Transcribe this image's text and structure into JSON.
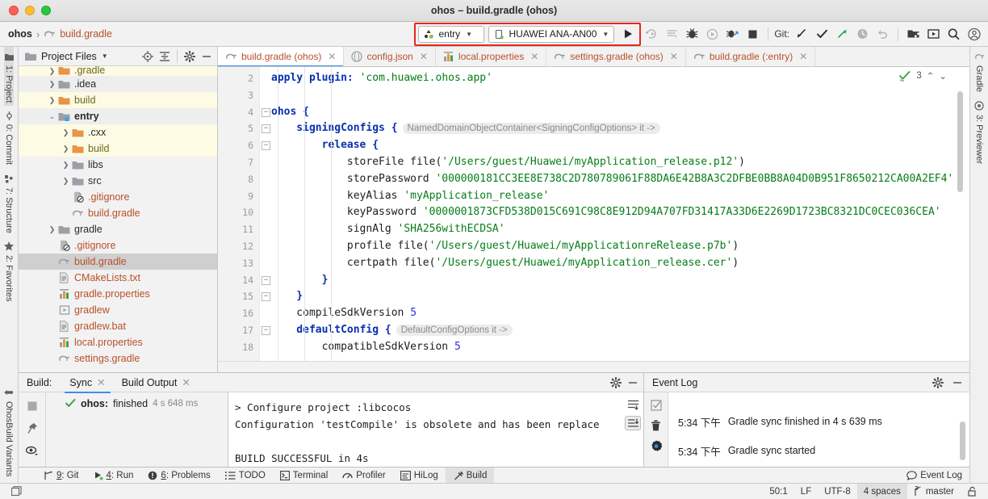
{
  "window": {
    "title": "ohos – build.gradle (ohos)"
  },
  "navbar": {
    "breadcrumb": {
      "root": "ohos",
      "separator": "›",
      "file": "build.gradle"
    },
    "run_config": "entry",
    "device": "HUAWEI ANA-AN00",
    "git_label": "Git:",
    "icons": [
      "run-icon",
      "rerun-icon",
      "run-tests-icon",
      "debug-icon",
      "profile-icon",
      "debug-attach-icon",
      "stop-icon",
      "update-project-icon",
      "commit-icon",
      "push-icon",
      "history-icon",
      "undo-icon",
      "device-manager-icon",
      "previewer-icon",
      "search-everywhere-icon",
      "account-icon"
    ]
  },
  "left_strip": [
    {
      "label": "1: Project",
      "icon": "project-icon",
      "active": true
    },
    {
      "label": "0: Commit",
      "icon": "commit-icon",
      "active": false
    },
    {
      "label": "7: Structure",
      "icon": "structure-icon",
      "active": false
    },
    {
      "label": "2: Favorites",
      "icon": "star-icon",
      "active": false
    },
    {
      "label": "OhosBuild Variants",
      "icon": "variants-icon",
      "active": false
    }
  ],
  "right_strip": [
    {
      "label": "Gradle",
      "icon": "gradle-elephant-icon"
    },
    {
      "label": "3: Previewer",
      "icon": "eye-icon"
    }
  ],
  "project_panel": {
    "title": "Project Files",
    "header_icons": [
      "locate-icon",
      "collapse-all-icon",
      "settings-icon",
      "hide-icon"
    ],
    "tree": [
      {
        "label": ".gradle",
        "depth": 1,
        "arrow": "right",
        "icon": "folder-orange",
        "color": "olive",
        "highlight": "yellow",
        "bold": false,
        "clipped": true
      },
      {
        "label": ".idea",
        "depth": 1,
        "arrow": "right",
        "icon": "folder-gray",
        "color": "dark",
        "highlight": "gray",
        "bold": false
      },
      {
        "label": "build",
        "depth": 1,
        "arrow": "right",
        "icon": "folder-orange",
        "color": "olive",
        "highlight": "yellow",
        "bold": false
      },
      {
        "label": "entry",
        "depth": 1,
        "arrow": "down",
        "icon": "folder-module",
        "color": "dark",
        "highlight": "gray",
        "bold": true
      },
      {
        "label": ".cxx",
        "depth": 2,
        "arrow": "right",
        "icon": "folder-orange",
        "color": "dark",
        "highlight": "yellow",
        "bold": false
      },
      {
        "label": "build",
        "depth": 2,
        "arrow": "right",
        "icon": "folder-orange",
        "color": "olive",
        "highlight": "yellow",
        "bold": false
      },
      {
        "label": "libs",
        "depth": 2,
        "arrow": "right",
        "icon": "folder-gray",
        "color": "dark",
        "highlight": "none",
        "bold": false
      },
      {
        "label": "src",
        "depth": 2,
        "arrow": "right",
        "icon": "folder-gray",
        "color": "dark",
        "highlight": "none",
        "bold": false
      },
      {
        "label": ".gitignore",
        "depth": 2,
        "arrow": "none",
        "icon": "gitignore-file",
        "color": "orange",
        "highlight": "none",
        "bold": false
      },
      {
        "label": "build.gradle",
        "depth": 2,
        "arrow": "none",
        "icon": "gradle-file",
        "color": "orange",
        "highlight": "none",
        "bold": false
      },
      {
        "label": "gradle",
        "depth": 1,
        "arrow": "right",
        "icon": "folder-gray",
        "color": "dark",
        "highlight": "none",
        "bold": false
      },
      {
        "label": ".gitignore",
        "depth": 1,
        "arrow": "none",
        "icon": "gitignore-file",
        "color": "orange",
        "highlight": "none",
        "bold": false
      },
      {
        "label": "build.gradle",
        "depth": 1,
        "arrow": "none",
        "icon": "gradle-file",
        "color": "orange",
        "highlight": "selected",
        "bold": false
      },
      {
        "label": "CMakeLists.txt",
        "depth": 1,
        "arrow": "none",
        "icon": "text-file",
        "color": "orange",
        "highlight": "none",
        "bold": false
      },
      {
        "label": "gradle.properties",
        "depth": 1,
        "arrow": "none",
        "icon": "properties-file",
        "color": "orange",
        "highlight": "none",
        "bold": false
      },
      {
        "label": "gradlew",
        "depth": 1,
        "arrow": "none",
        "icon": "script-file",
        "color": "orange",
        "highlight": "none",
        "bold": false
      },
      {
        "label": "gradlew.bat",
        "depth": 1,
        "arrow": "none",
        "icon": "text-file",
        "color": "orange",
        "highlight": "none",
        "bold": false
      },
      {
        "label": "local.properties",
        "depth": 1,
        "arrow": "none",
        "icon": "properties-file",
        "color": "orange",
        "highlight": "none",
        "bold": false
      },
      {
        "label": "settings.gradle",
        "depth": 1,
        "arrow": "none",
        "icon": "gradle-file",
        "color": "orange",
        "highlight": "none",
        "bold": false
      }
    ]
  },
  "editor": {
    "tabs": [
      {
        "label": "build.gradle (ohos)",
        "icon": "gradle-file",
        "active": true
      },
      {
        "label": "config.json",
        "icon": "json-file",
        "active": false
      },
      {
        "label": "local.properties",
        "icon": "properties-file",
        "active": false
      },
      {
        "label": "settings.gradle (ohos)",
        "icon": "gradle-file",
        "active": false
      },
      {
        "label": "build.gradle (:entry)",
        "icon": "gradle-file",
        "active": false
      }
    ],
    "inspection": {
      "count": "3",
      "icon": "inspection-ok-icon"
    },
    "first_line_number": 2,
    "lines": [
      {
        "n": "2",
        "fold": false,
        "segs": [
          {
            "t": "apply ",
            "c": "kw"
          },
          {
            "t": "plugin: ",
            "c": "kw"
          },
          {
            "t": "'com.huawei.ohos.app'",
            "c": "str"
          }
        ],
        "indent": 0
      },
      {
        "n": "3",
        "fold": false,
        "segs": [],
        "indent": 0
      },
      {
        "n": "4",
        "fold": true,
        "segs": [
          {
            "t": "ohos {",
            "c": "kw"
          }
        ],
        "indent": 0
      },
      {
        "n": "5",
        "fold": true,
        "segs": [
          {
            "t": "signingConfigs {",
            "c": "kw"
          }
        ],
        "indent": 1,
        "hint": "NamedDomainObjectContainer<SigningConfigOptions> it ->"
      },
      {
        "n": "6",
        "fold": true,
        "segs": [
          {
            "t": "release {",
            "c": "kw"
          }
        ],
        "indent": 2
      },
      {
        "n": "7",
        "fold": false,
        "segs": [
          {
            "t": "storeFile file(",
            "c": "plain"
          },
          {
            "t": "'/Users/guest/Huawei/myApplication_release.p12'",
            "c": "str"
          },
          {
            "t": ")",
            "c": "plain"
          }
        ],
        "indent": 3
      },
      {
        "n": "8",
        "fold": false,
        "segs": [
          {
            "t": "storePassword ",
            "c": "plain"
          },
          {
            "t": "'000000181CC3EE8E738C2D780789061F88DA6E42B8A3C2DFBE0BB8A04D0B951F8650212CA00A2EF4'",
            "c": "str"
          }
        ],
        "indent": 3
      },
      {
        "n": "9",
        "fold": false,
        "segs": [
          {
            "t": "keyAlias ",
            "c": "plain"
          },
          {
            "t": "'myApplication_release'",
            "c": "str"
          }
        ],
        "indent": 3
      },
      {
        "n": "10",
        "fold": false,
        "segs": [
          {
            "t": "keyPassword ",
            "c": "plain"
          },
          {
            "t": "'0000001873CFD538D015C691C98C8E912D94A707FD31417A33D6E2269D1723BC8321DC0CEC036CEA'",
            "c": "str"
          }
        ],
        "indent": 3
      },
      {
        "n": "11",
        "fold": false,
        "segs": [
          {
            "t": "signAlg ",
            "c": "plain"
          },
          {
            "t": "'SHA256withECDSA'",
            "c": "str"
          }
        ],
        "indent": 3
      },
      {
        "n": "12",
        "fold": false,
        "segs": [
          {
            "t": "profile file(",
            "c": "plain"
          },
          {
            "t": "'/Users/guest/Huawei/myApplicationreRelease.p7b'",
            "c": "str"
          },
          {
            "t": ")",
            "c": "plain"
          }
        ],
        "indent": 3
      },
      {
        "n": "13",
        "fold": false,
        "segs": [
          {
            "t": "certpath file(",
            "c": "plain"
          },
          {
            "t": "'/Users/guest/Huawei/myApplication_release.cer'",
            "c": "str"
          },
          {
            "t": ")",
            "c": "plain"
          }
        ],
        "indent": 3
      },
      {
        "n": "14",
        "fold": true,
        "segs": [
          {
            "t": "}",
            "c": "kw"
          }
        ],
        "indent": 2
      },
      {
        "n": "15",
        "fold": true,
        "segs": [
          {
            "t": "}",
            "c": "kw"
          }
        ],
        "indent": 1
      },
      {
        "n": "16",
        "fold": false,
        "segs": [
          {
            "t": "compileSdkVersion ",
            "c": "plain"
          },
          {
            "t": "5",
            "c": "num"
          }
        ],
        "indent": 1
      },
      {
        "n": "17",
        "fold": true,
        "segs": [
          {
            "t": "defaultConfig {",
            "c": "kw"
          }
        ],
        "indent": 1,
        "hint": "DefaultConfigOptions it ->"
      },
      {
        "n": "18",
        "fold": false,
        "segs": [
          {
            "t": "compatibleSdkVersion ",
            "c": "plain"
          },
          {
            "t": "5",
            "c": "num"
          }
        ],
        "indent": 2
      }
    ]
  },
  "build_panel": {
    "title": "Build:",
    "tabs": [
      {
        "label": "Sync",
        "active": true
      },
      {
        "label": "Build Output",
        "active": false
      }
    ],
    "strip_icons": [
      "stop-icon",
      "pin-icon",
      "eye-icon"
    ],
    "tree_item": {
      "module": "ohos:",
      "status": "finished",
      "time": "4 s 648 ms",
      "icon": "check-icon"
    },
    "console_lines": [
      "> Configure project :libcocos",
      "Configuration 'testCompile' is obsolete and has been replace",
      "",
      "BUILD SUCCESSFUL in 4s"
    ],
    "console_buttons": [
      "soft-wrap-icon",
      "scroll-to-end-icon"
    ]
  },
  "event_log": {
    "title": "Event Log",
    "header_icons": [
      "settings-icon",
      "hide-icon"
    ],
    "strip_icons": [
      "mark-read-icon",
      "trash-icon",
      "settings-gear-icon"
    ],
    "entries": [
      {
        "time": "5:34 下午",
        "message": "Gradle sync started",
        "icon": "info-icon"
      },
      {
        "time": "5:34 下午",
        "message": "Gradle sync finished in 4 s 639 ms",
        "icon": "info-icon"
      }
    ]
  },
  "tool_buttons": [
    {
      "label": "9: Git",
      "icon": "git-icon",
      "active": false
    },
    {
      "label": "4: Run",
      "icon": "run-icon",
      "active": false
    },
    {
      "label": "6: Problems",
      "icon": "problems-icon",
      "active": false
    },
    {
      "label": "TODO",
      "icon": "todo-icon",
      "active": false
    },
    {
      "label": "Terminal",
      "icon": "terminal-icon",
      "active": false
    },
    {
      "label": "Profiler",
      "icon": "profiler-icon",
      "active": false
    },
    {
      "label": "HiLog",
      "icon": "hilog-icon",
      "active": false
    },
    {
      "label": "Build",
      "icon": "build-icon",
      "active": true
    }
  ],
  "tool_buttons_right": {
    "label": "Event Log",
    "icon": "balloon-icon"
  },
  "status_bar": {
    "caret": "50:1",
    "line_sep": "LF",
    "encoding": "UTF-8",
    "indent": "4 spaces",
    "branch": "master",
    "lock_icon": "lock-icon",
    "branch_icon": "branch-icon",
    "left_icon": "memory-icon"
  },
  "colors": {
    "accent_blue": "#3b92e8",
    "highlight_red": "#e8271c",
    "string_green": "#067d17",
    "keyword_blue": "#0a2fb0",
    "file_orange": "#b8502a",
    "folder_orange": "#e8944a"
  }
}
